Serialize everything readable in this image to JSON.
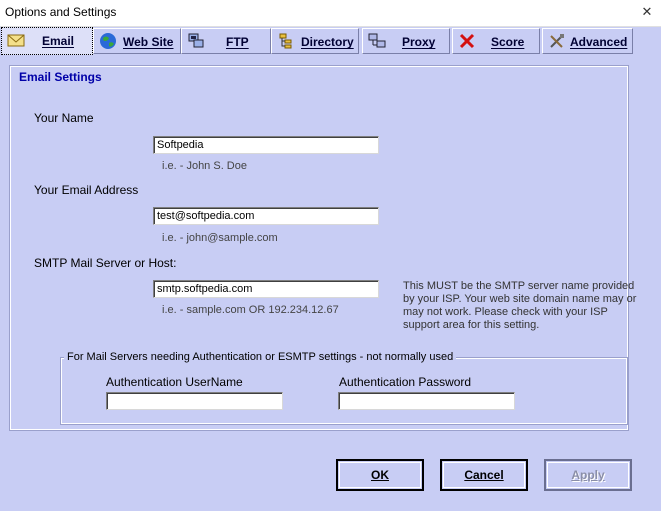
{
  "window": {
    "title": "Options and Settings",
    "close_symbol": "✕"
  },
  "tabs": [
    {
      "label": "Email",
      "icon": "envelope-icon",
      "active": true
    },
    {
      "label": "Web Site",
      "icon": "globe-icon"
    },
    {
      "label": "FTP",
      "icon": "ftp-computer-icon"
    },
    {
      "label": "Directory",
      "icon": "directory-tree-icon"
    },
    {
      "label": "Proxy",
      "icon": "proxy-network-icon"
    },
    {
      "label": "Score",
      "icon": "red-x-icon"
    },
    {
      "label": "Advanced",
      "icon": "tools-icon"
    }
  ],
  "email_settings": {
    "group_title": "Email Settings",
    "name_label": "Your Name",
    "name_value": "Softpedia",
    "name_hint": "i.e. - John S. Doe",
    "email_label": "Your Email Address",
    "email_value": "test@softpedia.com",
    "email_hint": "i.e. - john@sample.com",
    "smtp_label": "SMTP Mail Server or Host:",
    "smtp_value": "smtp.softpedia.com",
    "smtp_hint": "i.e. - sample.com OR 192.234.12.67",
    "smtp_note": "This MUST be the SMTP server name provided by your ISP. Your web site domain name may or may not work. Please check with your ISP support area for this setting."
  },
  "auth": {
    "group_title": "For Mail Servers needing Authentication or ESMTP settings - not normally used",
    "username_label": "Authentication UserName",
    "username_value": "",
    "password_label": "Authentication  Password",
    "password_value": ""
  },
  "buttons": {
    "ok": "OK",
    "cancel": "Cancel",
    "apply": "Apply"
  },
  "colors": {
    "background": "#c8cdf4",
    "group_title": "#0000a8"
  }
}
